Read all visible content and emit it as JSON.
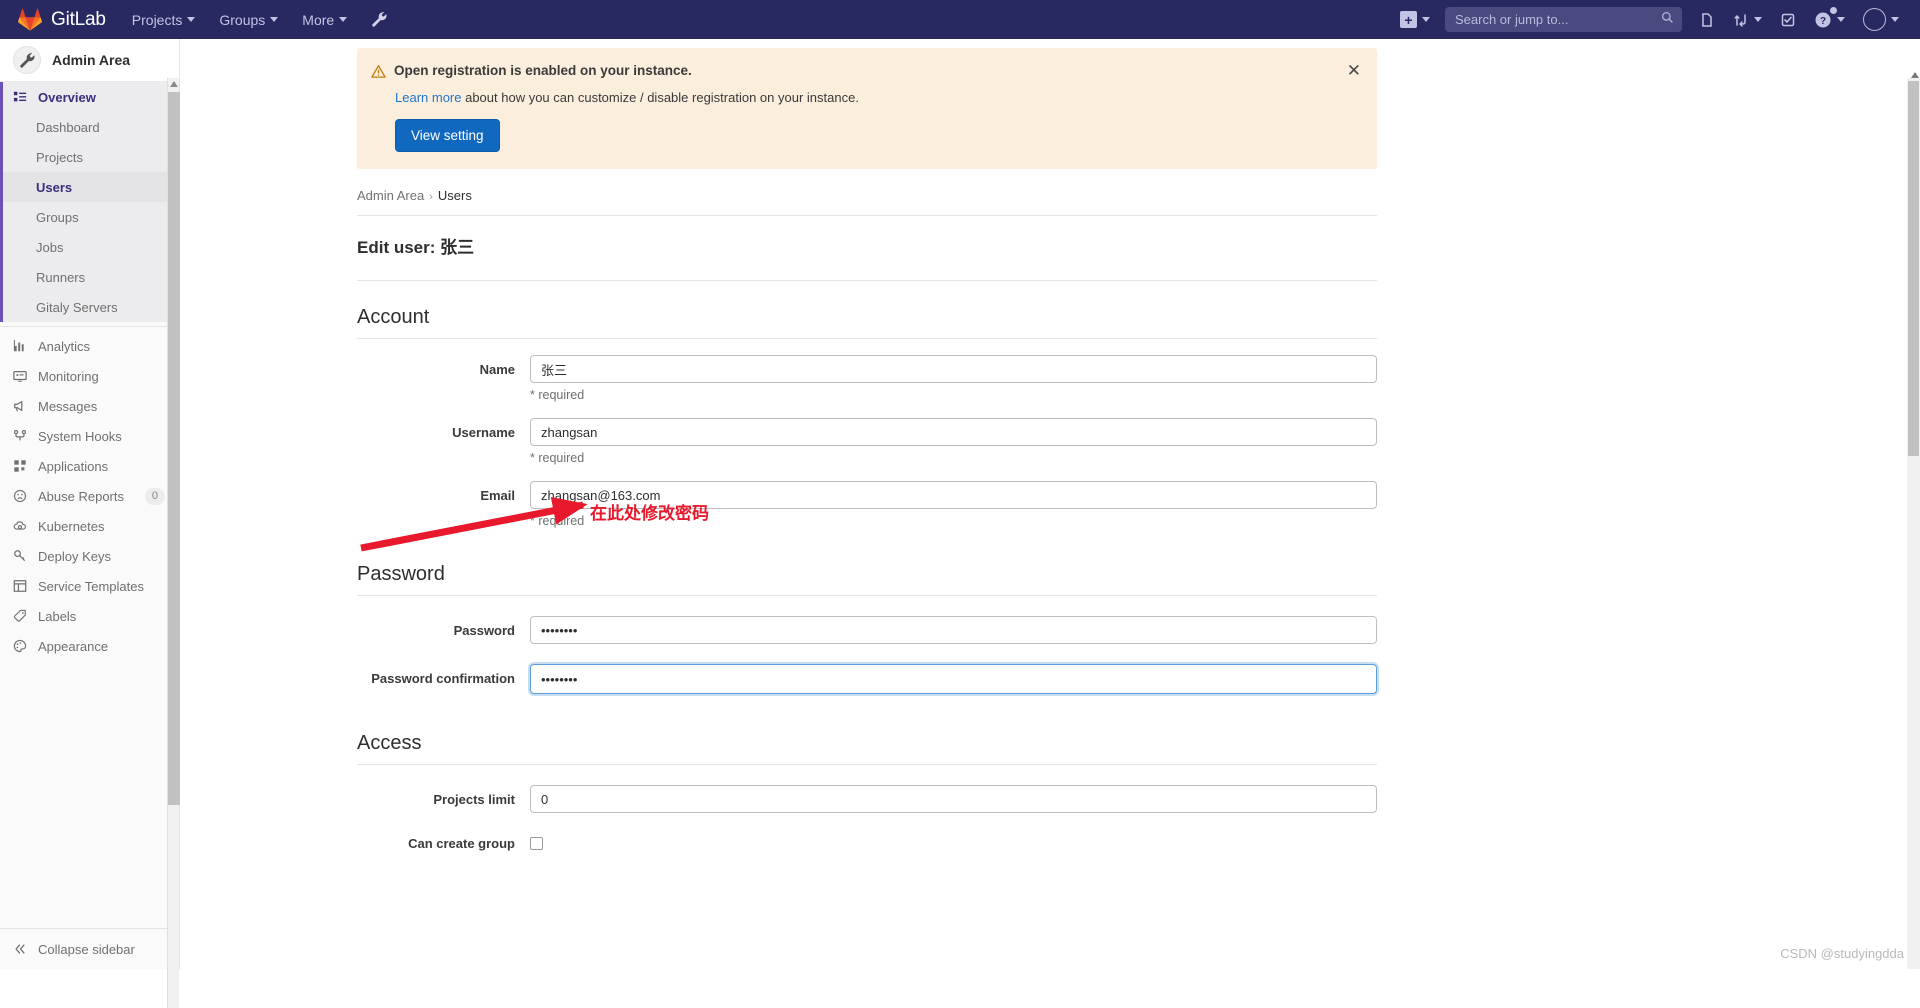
{
  "navbar": {
    "brand": "GitLab",
    "items": [
      {
        "label": "Projects",
        "icon": "chevron-down-icon"
      },
      {
        "label": "Groups",
        "icon": "chevron-down-icon"
      },
      {
        "label": "More",
        "icon": "chevron-down-icon"
      }
    ],
    "wrench_icon": "wrench-icon",
    "create_new_icon": "plus-square-icon",
    "search": {
      "placeholder": "Search or jump to...",
      "value": "",
      "icon": "search-icon"
    },
    "right_icons": [
      {
        "name": "issues-icon"
      },
      {
        "name": "merge-requests-icon"
      },
      {
        "name": "todos-icon"
      },
      {
        "name": "help-icon"
      },
      {
        "name": "user-avatar-icon"
      }
    ]
  },
  "sidebar": {
    "title": "Admin Area",
    "avatar_icon": "wrench-icon",
    "overview": {
      "label": "Overview",
      "icon": "overview-icon",
      "children": [
        {
          "label": "Dashboard",
          "current": false
        },
        {
          "label": "Projects",
          "current": false
        },
        {
          "label": "Users",
          "current": true
        },
        {
          "label": "Groups",
          "current": false
        },
        {
          "label": "Jobs",
          "current": false
        },
        {
          "label": "Runners",
          "current": false
        },
        {
          "label": "Gitaly Servers",
          "current": false
        }
      ]
    },
    "items": [
      {
        "label": "Analytics",
        "icon": "analytics-icon"
      },
      {
        "label": "Monitoring",
        "icon": "monitor-icon"
      },
      {
        "label": "Messages",
        "icon": "megaphone-icon"
      },
      {
        "label": "System Hooks",
        "icon": "hook-icon"
      },
      {
        "label": "Applications",
        "icon": "applications-icon"
      },
      {
        "label": "Abuse Reports",
        "icon": "abuse-icon",
        "badge": "0"
      },
      {
        "label": "Kubernetes",
        "icon": "kubernetes-icon"
      },
      {
        "label": "Deploy Keys",
        "icon": "key-icon"
      },
      {
        "label": "Service Templates",
        "icon": "template-icon"
      },
      {
        "label": "Labels",
        "icon": "label-icon"
      },
      {
        "label": "Appearance",
        "icon": "palette-icon"
      }
    ],
    "collapse": {
      "label": "Collapse sidebar",
      "icon": "double-chevron-left-icon"
    }
  },
  "alert": {
    "icon": "warning-triangle-icon",
    "title": "Open registration is enabled on your instance.",
    "link_text": "Learn more",
    "body_text": " about how you can customize / disable registration on your instance.",
    "button_label": "View setting",
    "close_icon": "close-icon",
    "background": "#fceedc"
  },
  "breadcrumb": {
    "root": "Admin Area",
    "separator": "›",
    "current": "Users"
  },
  "page_title": "Edit user: 张三",
  "sections": {
    "account": {
      "heading": "Account",
      "fields": [
        {
          "label": "Name",
          "value": "张三",
          "help": "* required",
          "focused": false
        },
        {
          "label": "Username",
          "value": "zhangsan",
          "help": "* required",
          "focused": false
        },
        {
          "label": "Email",
          "value": "zhangsan@163.com",
          "help": "* required",
          "focused": false
        }
      ]
    },
    "password": {
      "heading": "Password",
      "fields": [
        {
          "label": "Password",
          "value": "••••••••",
          "focused": false
        },
        {
          "label": "Password confirmation",
          "value": "••••••••",
          "focused": true
        }
      ]
    },
    "access": {
      "heading": "Access",
      "projects_limit_label": "Projects limit",
      "projects_limit_value": "0",
      "can_create_group_label": "Can create group"
    }
  },
  "annotation": {
    "text": "在此处修改密码",
    "color": "#e8192c",
    "arrow": "red-arrow-icon"
  },
  "watermark": "CSDN @studyingdda"
}
